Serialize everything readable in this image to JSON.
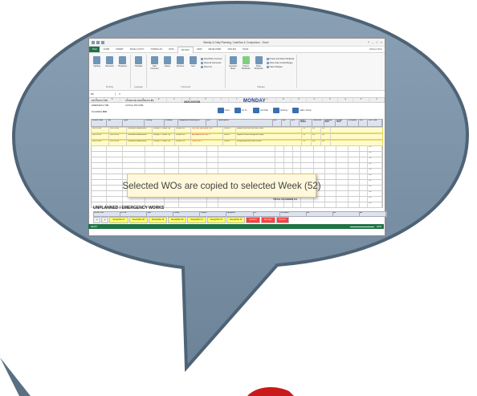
{
  "window": {
    "title": "Weekly & Daily Planning, Cashflow & Comparison - Excel",
    "controls": [
      "?",
      "–",
      "□",
      "×"
    ]
  },
  "ribbon": {
    "tabs": [
      "FILE",
      "HOME",
      "INSERT",
      "PAGE LAYOUT",
      "FORMULAS",
      "DATA",
      "REVIEW",
      "VIEW",
      "DEVELOPER",
      "ADD-INS",
      "TEAM"
    ],
    "active_tab": "REVIEW",
    "user": "Rabeya Khan",
    "groups": [
      {
        "label": "Proofing",
        "buttons": [
          "Spelling",
          "Research",
          "Thesaurus"
        ]
      },
      {
        "label": "Language",
        "buttons": [
          "Translate"
        ]
      },
      {
        "label": "Comments",
        "buttons": [
          "New Comment",
          "Delete",
          "Previous",
          "Next"
        ],
        "list": [
          "Show/Hide Comment",
          "Show All Comments",
          "Show Ink"
        ]
      },
      {
        "label": "Changes",
        "buttons": [
          "Unprotect Sheet",
          "Protect Workbook",
          "Share Workbook"
        ],
        "list": [
          "Protect and Share Workbook",
          "Allow Users to Edit Ranges",
          "Track Changes"
        ]
      }
    ]
  },
  "formula_bar": {
    "name_box": "D9",
    "fx": "fx",
    "value": ""
  },
  "columns": [
    "A",
    "B",
    "C",
    "D",
    "E",
    "F",
    "G",
    "H",
    "I",
    "J",
    "K",
    "L",
    "M",
    "N",
    "O",
    "P",
    "Q",
    "R",
    "S"
  ],
  "header_info": {
    "kpis": [
      {
        "label": "EFFICIENCY",
        "value": "0%"
      },
      {
        "label": "EMERGENCY",
        "value": "0%"
      },
      {
        "label": "SCHEDULE ADHERENCE",
        "value": "0%"
      },
      {
        "label": "ACTUAL PM %",
        "value": "0%"
      },
      {
        "label": "PLANNING",
        "value": "80%"
      }
    ],
    "date": "28/12/2018",
    "day": "MONDAY",
    "tools": [
      "Index",
      "Go To...",
      "Sort Plan",
      "All Every",
      "Mark / Check"
    ]
  },
  "table": {
    "headers": [
      "Sched. Date",
      "WO",
      "Type",
      "Priority",
      "Problem",
      "Equipment Description",
      "WO",
      "Description",
      "Hrs",
      "Est",
      "Act",
      "Work Status",
      "Overtime",
      "Planned Start",
      "Actual Start",
      "Complete",
      "Hrs",
      "Est. Total"
    ],
    "rows": [
      [
        "28/12/2018",
        "28/12/2018",
        "Preventive Maintenance",
        "Priority 2 - Please Try",
        "PM-BLD-01",
        "CHILLER PACKAGE UNIT",
        "PM-015",
        "Replace filter unit and check seals",
        "2.0",
        "0.0",
        "0.0"
      ],
      [
        "28/12/2018",
        "28/12/2018",
        "Preventive Maintenance",
        "Priority 2 - Please Try",
        "PM-BLD-02",
        "AIR HANDLING UNIT 2",
        "PM-017",
        "Replace oil filter and grease sump",
        "2.0",
        "0.0",
        "0.0"
      ],
      [
        "28/12/2018",
        "28/12/2018",
        "Preventive Maintenance",
        "Priority 2 - Please Try",
        "PM-BLD-03",
        "PUMP SET 3",
        "PM-019",
        "Re-tight gland box and fix leaks",
        "2.0",
        "0.0",
        "0.0"
      ]
    ],
    "empty_totals": [
      "0.0",
      "0.0",
      "0.0",
      "0.0",
      "0.0",
      "0.0",
      "0.0",
      "0.0",
      "0.0",
      "0.0",
      "0.0"
    ]
  },
  "tooltip": {
    "text": "Selected WOs are copied to selected Week (52)"
  },
  "total_planned": {
    "label": "TOTAL PLANNED",
    "value": "0.0"
  },
  "unplanned": {
    "title": "UNPLANNED / EMERGENCY WORKS",
    "headers": [
      "Sched. Date",
      "WO No.",
      "Type",
      "Priority",
      "Problem",
      "Equipment",
      "WO",
      "Description",
      "Hrs",
      "Est",
      "Act"
    ]
  },
  "sheet_tabs": [
    "WeeklyPlan 47",
    "WeeklyPlan 48",
    "WeeklyPlan 49",
    "WeeklyPlan 50",
    "WeeklyPlan 51",
    "WeeklyPlan 52",
    "WeeklyPlan 53",
    "Cashflow",
    "Summary",
    "Reports"
  ],
  "status_bar": {
    "left": "READY",
    "zoom": "100%"
  },
  "colors": {
    "excel_green": "#217346",
    "bubble": "#7a8fa3",
    "tooltip_bg": "#fff8dc",
    "selection": "#fffbcc"
  }
}
